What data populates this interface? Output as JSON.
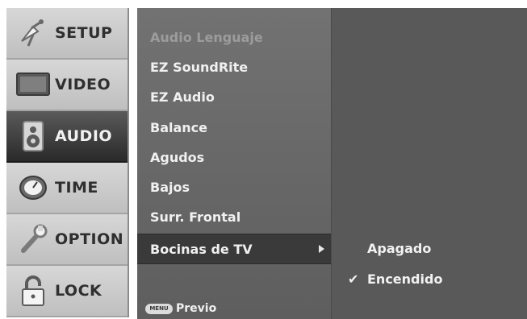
{
  "categories": [
    {
      "label": "SETUP",
      "icon": "satellite-icon"
    },
    {
      "label": "VIDEO",
      "icon": "tv-icon"
    },
    {
      "label": "AUDIO",
      "icon": "speaker-icon"
    },
    {
      "label": "TIME",
      "icon": "clock-icon"
    },
    {
      "label": "OPTION",
      "icon": "wrench-icon"
    },
    {
      "label": "LOCK",
      "icon": "padlock-icon"
    }
  ],
  "active_category": "AUDIO",
  "submenu": {
    "items": [
      {
        "label": "Audio Lenguaje",
        "state": "disabled"
      },
      {
        "label": "EZ SoundRite",
        "state": "normal"
      },
      {
        "label": "EZ Audio",
        "state": "normal"
      },
      {
        "label": "Balance",
        "state": "normal"
      },
      {
        "label": "Agudos",
        "state": "normal"
      },
      {
        "label": "Bajos",
        "state": "normal"
      },
      {
        "label": "Surr. Frontal",
        "state": "normal"
      },
      {
        "label": "Bocinas de TV",
        "state": "selected"
      }
    ],
    "footer": {
      "key_label": "MENU",
      "text": "Previo"
    }
  },
  "options": {
    "items": [
      {
        "label": "Apagado",
        "checked": false
      },
      {
        "label": "Encendido",
        "checked": true
      }
    ],
    "check_glyph": "✔"
  },
  "colors": {
    "category_bg": "#d7d7d7",
    "category_active_bg": "#2a2a2a",
    "submenu_bg": "#6a6a6a",
    "submenu_selected_bg": "#3a3a3a",
    "options_bg": "#595959",
    "text_light": "#f0f0f0",
    "text_disabled": "#9c9c9c"
  }
}
